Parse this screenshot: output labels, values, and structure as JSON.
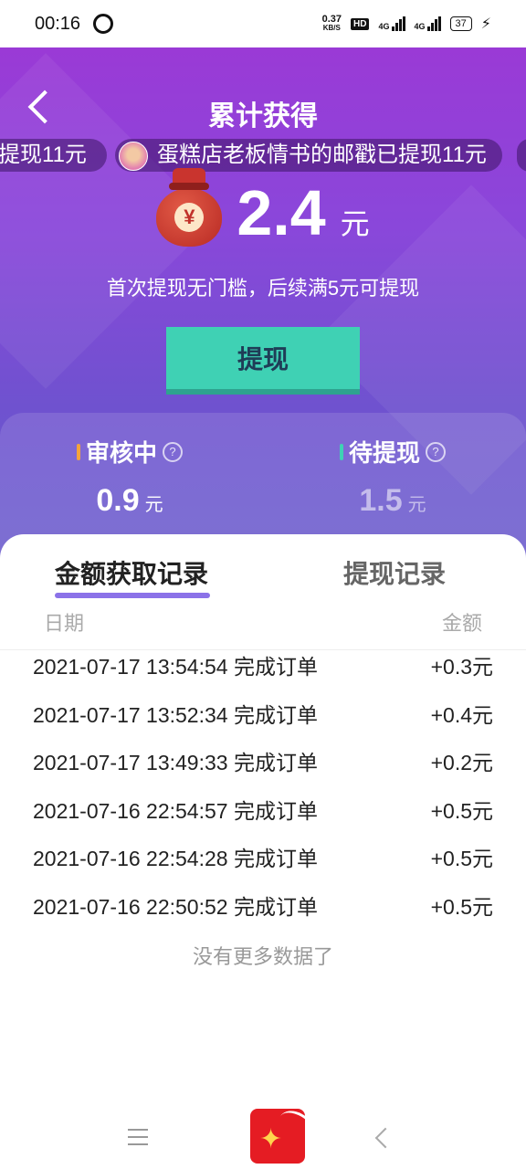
{
  "status_bar": {
    "time": "00:16",
    "speed_value": "0.37",
    "speed_unit": "KB/S",
    "hd": "HD",
    "net1": "4G",
    "net2": "4G",
    "battery": "37"
  },
  "header": {
    "title": "累计获得"
  },
  "ticker": {
    "left_text": "提现11元",
    "main_text": "蛋糕店老板情书的邮戳已提现11元"
  },
  "summary": {
    "amount": "2.4",
    "unit": "元",
    "currency_symbol": "¥",
    "hint": "首次提现无门槛，后续满5元可提现",
    "withdraw_label": "提现"
  },
  "stats": [
    {
      "label": "审核中",
      "value": "0.9",
      "unit": "元",
      "bar_color": "#f4a43c"
    },
    {
      "label": "待提现",
      "value": "1.5",
      "unit": "元",
      "bar_color": "#3fd1b4"
    }
  ],
  "tabs": {
    "earnings": "金额获取记录",
    "withdrawals": "提现记录",
    "active": "earnings"
  },
  "columns": {
    "date": "日期",
    "amount": "金额"
  },
  "records": [
    {
      "desc": "2021-07-17 13:54:54 完成订单",
      "amount": "+0.3元"
    },
    {
      "desc": "2021-07-17 13:52:34 完成订单",
      "amount": "+0.4元"
    },
    {
      "desc": "2021-07-17 13:49:33 完成订单",
      "amount": "+0.2元"
    },
    {
      "desc": "2021-07-16 22:54:57 完成订单",
      "amount": "+0.5元"
    },
    {
      "desc": "2021-07-16 22:54:28 完成订单",
      "amount": "+0.5元"
    },
    {
      "desc": "2021-07-16 22:50:52 完成订单",
      "amount": "+0.5元"
    }
  ],
  "no_more": "没有更多数据了",
  "colors": {
    "hero_top": "#9a3ad6",
    "hero_bottom": "#6a5ccc",
    "accent": "#3fd1b4",
    "tab_indicator": "#8b72e8"
  }
}
